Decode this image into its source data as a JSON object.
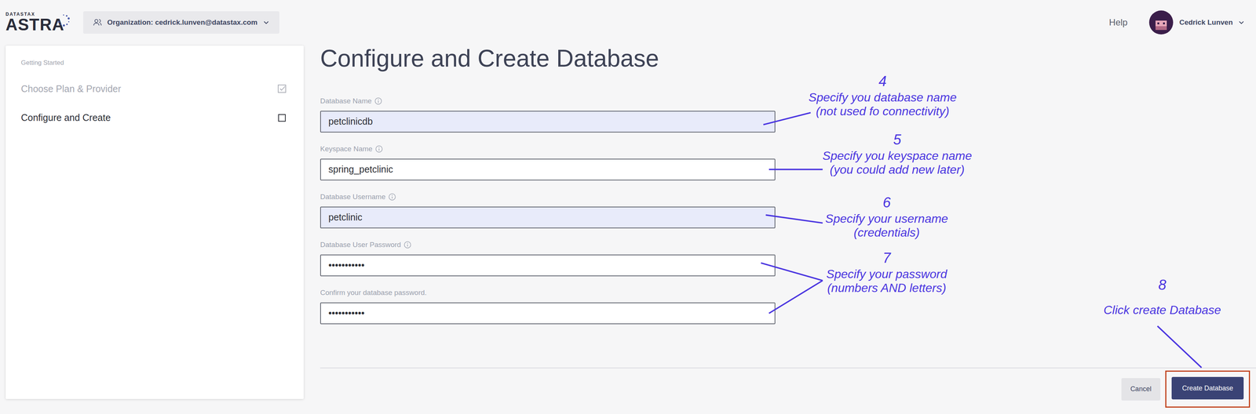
{
  "header": {
    "logo_small": "DATASTAX",
    "logo": "ASTRA",
    "organization": "Organization: cedrick.lunven@datastax.com",
    "help": "Help",
    "user": "Cedrick Lunven"
  },
  "steps": {
    "heading": "Getting Started",
    "items": [
      {
        "label": "Choose Plan & Provider",
        "checked": true,
        "selected": false
      },
      {
        "label": "Configure and Create",
        "checked": false,
        "selected": true
      }
    ]
  },
  "title": "Configure and Create Database",
  "fields": [
    {
      "label": "Database Name",
      "info": true,
      "value": "petclinicdb",
      "autofilled": true
    },
    {
      "label": "Keyspace Name",
      "info": true,
      "value": "spring_petclinic",
      "autofilled": false
    },
    {
      "label": "Database Username",
      "info": true,
      "value": "petclinic",
      "autofilled": true
    },
    {
      "label": "Database User Password",
      "info": true,
      "value": "•••••••••••",
      "autofilled": false
    },
    {
      "label": "Confirm your database password.",
      "info": false,
      "value": "•••••••••••",
      "autofilled": false
    }
  ],
  "buttons": [
    {
      "label": "Cancel",
      "kind": "secondary",
      "highlighted": false
    },
    {
      "label": "Create Database",
      "kind": "primary",
      "highlighted": true
    }
  ],
  "annotations": [
    {
      "number": "4",
      "lines": [
        "Specify you database name",
        "(not used fo connectivity)"
      ]
    },
    {
      "number": "5",
      "lines": [
        "Specify you keyspace name",
        "(you could add new later)"
      ]
    },
    {
      "number": "6",
      "lines": [
        "Specify your username",
        "(credentials)"
      ]
    },
    {
      "number": "7",
      "lines": [
        "Specify your password",
        "(numbers AND letters)"
      ]
    },
    {
      "number": "8",
      "lines": [
        "Click create Database"
      ]
    }
  ]
}
